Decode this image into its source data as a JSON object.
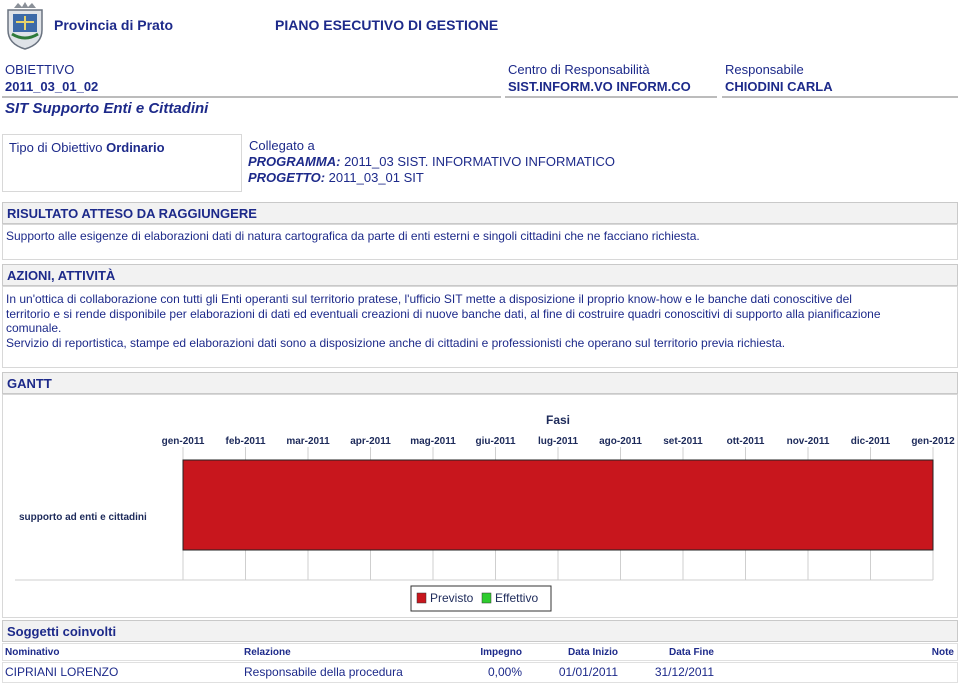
{
  "header": {
    "province": "Provincia di Prato",
    "doc_title": "PIANO ESECUTIVO DI GESTIONE"
  },
  "objective": {
    "label": "OBIETTIVO",
    "code": "2011_03_01_02",
    "centre_label": "Centro di Responsabilità",
    "centre_value": "SIST.INFORM.VO INFORM.CO",
    "resp_label": "Responsabile",
    "resp_value": "CHIODINI CARLA",
    "name": "SIT Supporto Enti e Cittadini"
  },
  "tipo": {
    "label": "Tipo di Obiettivo",
    "value": "Ordinario",
    "linked_label": "Collegato a",
    "programma_label": "PROGRAMMA:",
    "programma_value": "2011_03 SIST. INFORMATIVO INFORMATICO",
    "progetto_label": "PROGETTO:",
    "progetto_value": "2011_03_01 SIT"
  },
  "risultato": {
    "title": "RISULTATO ATTESO DA RAGGIUNGERE",
    "text": "Supporto alle esigenze di elaborazioni dati di natura cartografica da parte di enti esterni e singoli cittadini che ne facciano richiesta."
  },
  "azioni": {
    "title": "AZIONI, ATTIVITÀ",
    "line1": "In un'ottica di collaborazione con tutti gli Enti operanti sul territorio pratese, l'ufficio SIT mette a disposizione il proprio know-how e le banche dati conoscitive del",
    "line2": "territorio e si rende disponibile per elaborazioni di dati ed eventuali creazioni di nuove banche dati, al fine di costruire quadri conoscitivi di supporto alla pianificazione",
    "line3": "comunale.",
    "line4": "Servizio di reportistica, stampe ed elaborazioni dati sono a disposizione anche di cittadini e professionisti che operano sul territorio previa richiesta."
  },
  "gantt": {
    "section_title": "GANTT",
    "chart_title": "Fasi",
    "months": [
      "gen-2011",
      "feb-2011",
      "mar-2011",
      "apr-2011",
      "mag-2011",
      "giu-2011",
      "lug-2011",
      "ago-2011",
      "set-2011",
      "ott-2011",
      "nov-2011",
      "dic-2011",
      "gen-2012"
    ],
    "task_label": "supporto ad enti e cittadini",
    "legend": [
      {
        "label": "Previsto",
        "color": "#c8161d"
      },
      {
        "label": "Effettivo",
        "color": "#2ecc2e"
      }
    ]
  },
  "chart_data": {
    "type": "gantt",
    "title": "Fasi",
    "x_ticks": [
      "gen-2011",
      "feb-2011",
      "mar-2011",
      "apr-2011",
      "mag-2011",
      "giu-2011",
      "lug-2011",
      "ago-2011",
      "set-2011",
      "ott-2011",
      "nov-2011",
      "dic-2011",
      "gen-2012"
    ],
    "tasks": [
      {
        "name": "supporto ad enti e cittadini",
        "series": "Previsto",
        "start": "2011-01-01",
        "end": "2011-12-31"
      }
    ],
    "series": [
      {
        "name": "Previsto",
        "color": "#c8161d"
      },
      {
        "name": "Effettivo",
        "color": "#2ecc2e"
      }
    ],
    "legend_position": "bottom",
    "grid": true
  },
  "soggetti": {
    "title": "Soggetti coinvolti",
    "headers": [
      "Nominativo",
      "Relazione",
      "Impegno",
      "Data Inizio",
      "Data Fine",
      "Note"
    ],
    "rows": [
      [
        "CIPRIANI LORENZO",
        "Responsabile della procedura",
        "0,00%",
        "01/01/2011",
        "31/12/2011",
        ""
      ]
    ]
  }
}
